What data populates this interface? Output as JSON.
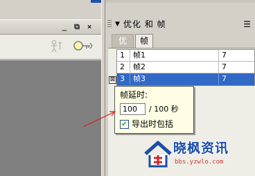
{
  "document_window": {
    "minimize_label": "_",
    "restore_label": "⧉",
    "close_label": "×",
    "edit_symbols_icon": "puppet-icon",
    "view_options_icon": "magnifier-icon"
  },
  "panel": {
    "title": "优化 和 帧",
    "collapse_glyph": "▼",
    "menu_glyph": "☰",
    "tabs": [
      {
        "label": "优化",
        "active": false
      },
      {
        "label": "帧",
        "active": true
      }
    ],
    "frames": [
      {
        "index": "1",
        "name": "帧1",
        "delay": "7",
        "selected": false
      },
      {
        "index": "2",
        "name": "帧2",
        "delay": "7",
        "selected": false
      },
      {
        "index": "3",
        "name": "帧3",
        "delay": "7",
        "selected": true
      }
    ],
    "row_marker": "⊠"
  },
  "delay_popup": {
    "label": "帧延时:",
    "value": "100",
    "unit": "/ 100 秒",
    "export_label": "导出时包括",
    "export_checked": true,
    "check_glyph": "✔"
  },
  "watermark": {
    "title": "晓枫资讯",
    "url": "bbs.yzwlo.com"
  },
  "colors": {
    "selection": "#3169c6",
    "popup_bg": "#fffee4",
    "arrow": "#d42020",
    "watermark_blue": "#1b4ea6",
    "watermark_red": "#c93c3c"
  }
}
